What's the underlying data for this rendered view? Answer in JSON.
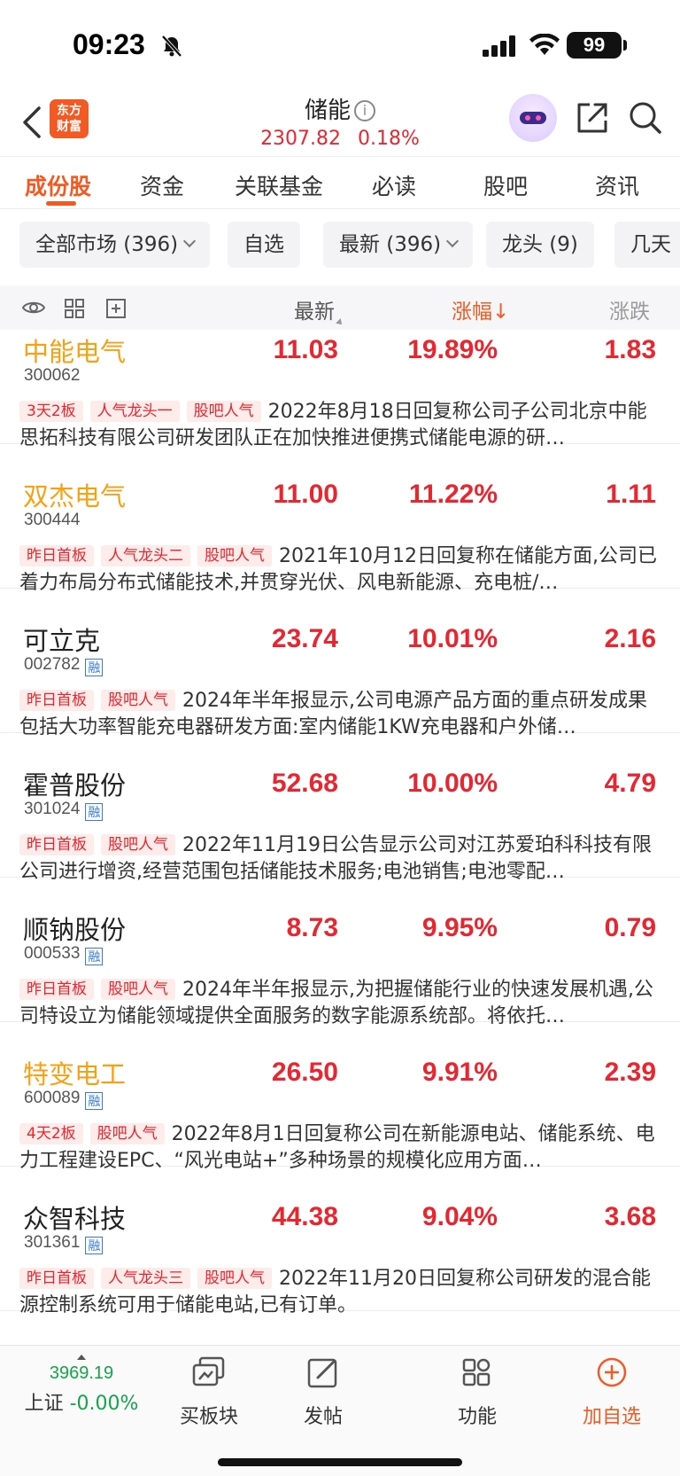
{
  "status_bar": {
    "time": "09:23",
    "battery": "99"
  },
  "header": {
    "logo_line1": "东方",
    "logo_line2": "财富",
    "title": "储能",
    "info_glyph": "i",
    "index_value": "2307.82",
    "index_change": "0.18%"
  },
  "tabs": [
    {
      "label": "成份股",
      "active": true
    },
    {
      "label": "资金"
    },
    {
      "label": "关联基金"
    },
    {
      "label": "必读"
    },
    {
      "label": "股吧"
    },
    {
      "label": "资讯"
    }
  ],
  "filters": [
    {
      "label": "全部市场 (396)",
      "dropdown": true
    },
    {
      "label": "自选"
    },
    {
      "label": "最新 (396)",
      "dropdown": true
    },
    {
      "label": "龙头 (9)"
    },
    {
      "label": "几天"
    }
  ],
  "columns": {
    "latest": "最新",
    "change_pct": "涨幅",
    "sort_arrow": "↓",
    "change": "涨跌"
  },
  "stocks": [
    {
      "name": "中能电气",
      "code": "300062",
      "margin": false,
      "hot": true,
      "price": "11.03",
      "pct": "19.89%",
      "chg": "1.83",
      "tags": [
        "3天2板",
        "人气龙头一",
        "股吧人气"
      ],
      "desc": "2022年8月18日回复称公司子公司北京中能思拓科技有限公司研发团队正在加快推进便携式储能电源的研…"
    },
    {
      "name": "双杰电气",
      "code": "300444",
      "margin": false,
      "hot": true,
      "price": "11.00",
      "pct": "11.22%",
      "chg": "1.11",
      "tags": [
        "昨日首板",
        "人气龙头二",
        "股吧人气"
      ],
      "desc": "2021年10月12日回复称在储能方面,公司已着力布局分布式储能技术,并贯穿光伏、风电新能源、充电桩/…"
    },
    {
      "name": "可立克",
      "code": "002782",
      "margin": true,
      "hot": false,
      "price": "23.74",
      "pct": "10.01%",
      "chg": "2.16",
      "tags": [
        "昨日首板",
        "股吧人气"
      ],
      "desc": "2024年半年报显示,公司电源产品方面的重点研发成果包括大功率智能充电器研发方面:室内储能1KW充电器和户外储…"
    },
    {
      "name": "霍普股份",
      "code": "301024",
      "margin": true,
      "hot": false,
      "price": "52.68",
      "pct": "10.00%",
      "chg": "4.79",
      "tags": [
        "昨日首板",
        "股吧人气"
      ],
      "desc": "2022年11月19日公告显示公司对江苏爱珀科科技有限公司进行增资,经营范围包括储能技术服务;电池销售;电池零配…"
    },
    {
      "name": "顺钠股份",
      "code": "000533",
      "margin": true,
      "hot": false,
      "price": "8.73",
      "pct": "9.95%",
      "chg": "0.79",
      "tags": [
        "昨日首板",
        "股吧人气"
      ],
      "desc": "2024年半年报显示,为把握储能行业的快速发展机遇,公司特设立为储能领域提供全面服务的数字能源系统部。将依托…"
    },
    {
      "name": "特变电工",
      "code": "600089",
      "margin": true,
      "hot": true,
      "price": "26.50",
      "pct": "9.91%",
      "chg": "2.39",
      "tags": [
        "4天2板",
        "股吧人气"
      ],
      "desc": "2022年8月1日回复称公司在新能源电站、储能系统、电力工程建设EPC、“风光电站+”多种场景的规模化应用方面…"
    },
    {
      "name": "众智科技",
      "code": "301361",
      "margin": true,
      "hot": false,
      "price": "44.38",
      "pct": "9.04%",
      "chg": "3.68",
      "tags": [
        "昨日首板",
        "人气龙头三",
        "股吧人气"
      ],
      "desc": "2022年11月20日回复称公司研发的混合能源控制系统可用于储能电站,已有订单。"
    }
  ],
  "margin_badge": "融",
  "bottom_bar": {
    "index_value": "3969.19",
    "index_name": "上证",
    "index_change": "-0.00%",
    "items": [
      "买板块",
      "发帖",
      "功能",
      "加自选"
    ]
  },
  "colors": {
    "accent": "#f15a22",
    "up": "#e8262f",
    "down": "#17a34a",
    "hot_name": "#f6a114",
    "margin": "#3a7bd5"
  }
}
